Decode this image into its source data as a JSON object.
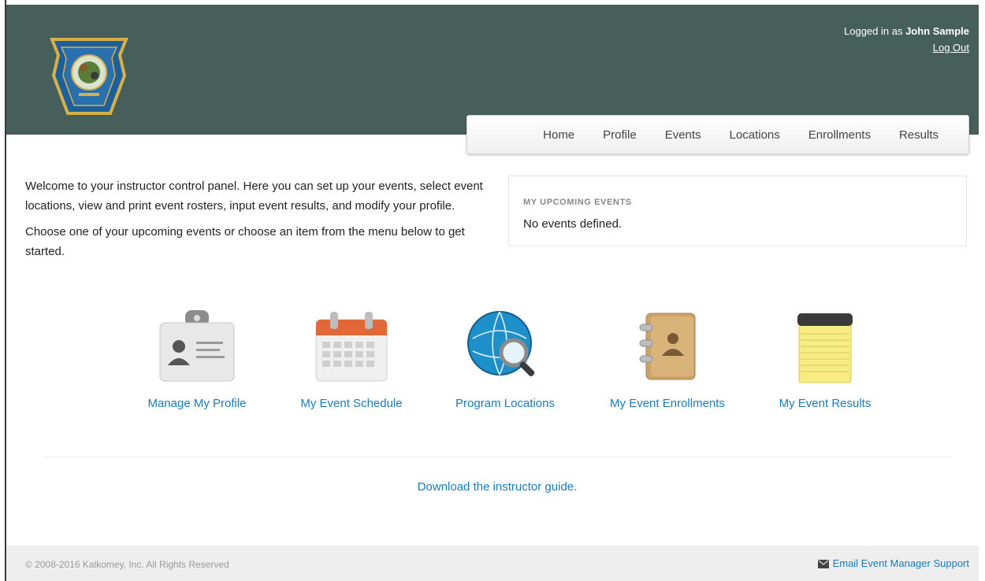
{
  "header": {
    "user": {
      "prefix": "Logged in as",
      "name": "John Sample",
      "logout_label": "Log Out"
    }
  },
  "nav": {
    "items": [
      "Home",
      "Profile",
      "Events",
      "Locations",
      "Enrollments",
      "Results"
    ]
  },
  "intro": {
    "p1": "Welcome to your instructor control panel. Here you can set up your events, select event locations, view and print event rosters, input event results, and modify your profile.",
    "p2": "Choose one of your upcoming events or choose an item from the menu below to get started."
  },
  "upcoming": {
    "heading": "MY UPCOMING EVENTS",
    "empty_text": "No events defined."
  },
  "tiles": [
    {
      "label": "Manage My Profile",
      "icon": "id-badge-icon"
    },
    {
      "label": "My Event Schedule",
      "icon": "calendar-icon"
    },
    {
      "label": "Program Locations",
      "icon": "globe-search-icon"
    },
    {
      "label": "My Event Enrollments",
      "icon": "address-book-icon"
    },
    {
      "label": "My Event Results",
      "icon": "notepad-icon"
    }
  ],
  "guide_link": "Download the instructor guide.",
  "footer": {
    "copyright": "© 2008-2016 Kalkomey, Inc. All Rights Reserved",
    "support_label": "Email Event Manager Support"
  },
  "colors": {
    "header_bg": "#475f5b",
    "link": "#1a7bb9"
  }
}
